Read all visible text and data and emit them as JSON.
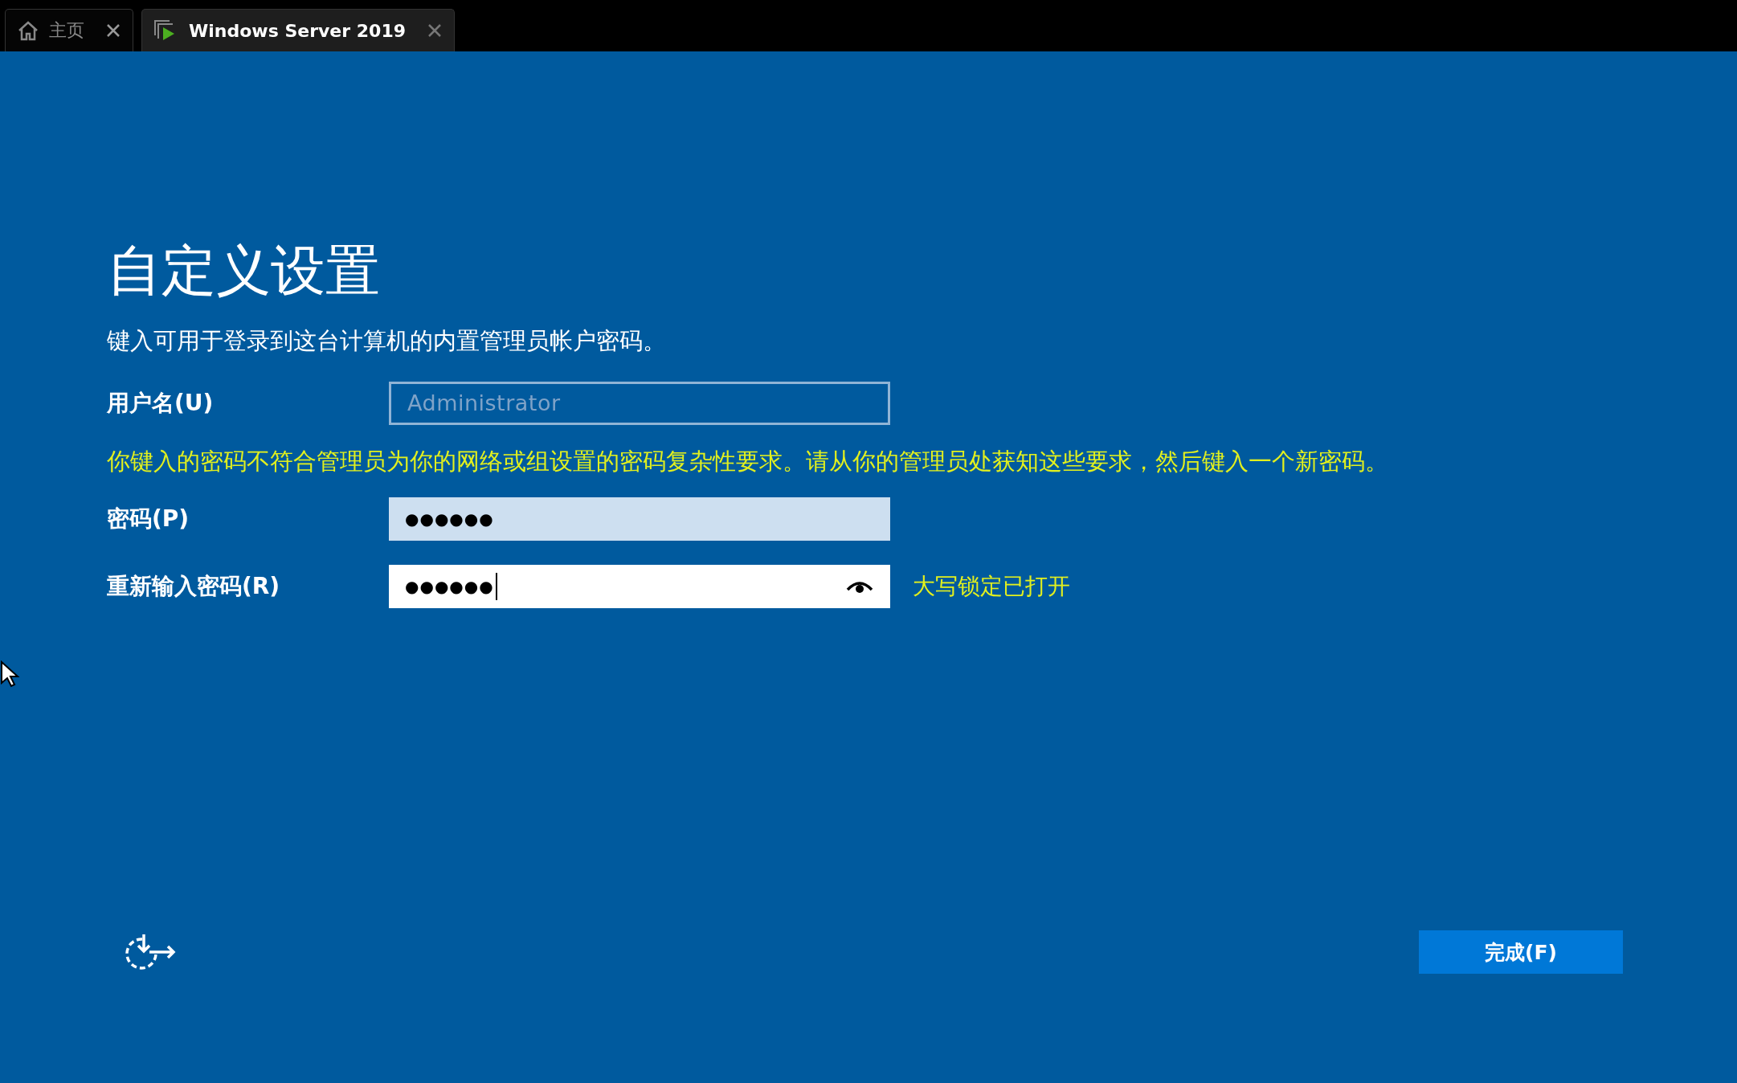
{
  "tabs": [
    {
      "label": "主页",
      "kind": "home",
      "selected": false
    },
    {
      "label": "Windows Server 2019",
      "kind": "vm",
      "selected": true
    }
  ],
  "title": "自定义设置",
  "description": "键入可用于登录到这台计算机的内置管理员帐户密码。",
  "fields": [
    {
      "label": "用户名(U)",
      "value": "Administrator",
      "disabled": true,
      "focused": false,
      "reveal": false
    },
    {
      "label": "密码(P)",
      "value": "●●●●●●",
      "disabled": false,
      "focused": false,
      "reveal": false
    },
    {
      "label": "重新输入密码(R)",
      "value": "●●●●●●",
      "disabled": false,
      "focused": true,
      "reveal": true,
      "note": "大写锁定已打开"
    }
  ],
  "error": "你键入的密码不符合管理员为你的网络或组设置的密码复杂性要求。请从你的管理员处获知这些要求，然后键入一个新密码。",
  "finish_button": "完成(F)"
}
